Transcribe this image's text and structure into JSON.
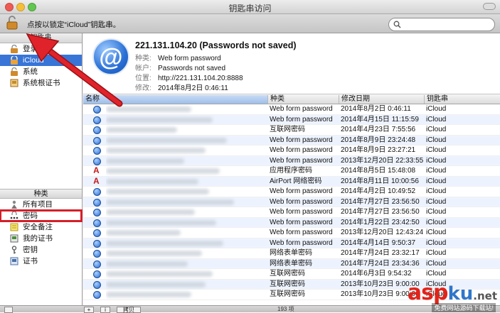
{
  "window": {
    "title": "钥匙串访问"
  },
  "toolbar": {
    "lock_label": "点按以锁定“iCloud”钥匙串。",
    "search_placeholder": ""
  },
  "sidebar": {
    "keychains_header": "钥匙串",
    "keychains": [
      {
        "label": "登录",
        "icon": "lock-icon"
      },
      {
        "label": "iCloud",
        "icon": "cloud-icon"
      },
      {
        "label": "系统",
        "icon": "lock-icon"
      },
      {
        "label": "系统根证书",
        "icon": "certificate-icon"
      }
    ],
    "category_header": "种类",
    "categories": [
      {
        "label": "所有项目",
        "icon": "people-icon"
      },
      {
        "label": "密码",
        "icon": "password-icon"
      },
      {
        "label": "安全备注",
        "icon": "note-icon"
      },
      {
        "label": "我的证书",
        "icon": "certificate-icon"
      },
      {
        "label": "密钥",
        "icon": "key-icon"
      },
      {
        "label": "证书",
        "icon": "certificate-icon"
      }
    ]
  },
  "detail": {
    "title": "221.131.104.20 (Passwords not saved)",
    "kind_label": "种类:",
    "kind": "Web form password",
    "account_label": "帐户:",
    "account": "Passwords not saved",
    "where_label": "位置:",
    "where": "http://221.131.104.20:8888",
    "modified_label": "修改:",
    "modified": "2014年8月2日 0:46:11"
  },
  "table": {
    "columns": [
      "名称",
      "种类",
      "修改日期",
      "钥匙串"
    ],
    "rows": [
      {
        "icon": "at",
        "kind": "Web form password",
        "date": "2014年8月2日 0:46:11",
        "chain": "iCloud"
      },
      {
        "icon": "at",
        "kind": "Web form password",
        "date": "2014年4月15日 11:15:59",
        "chain": "iCloud"
      },
      {
        "icon": "at",
        "kind": "互联网密码",
        "date": "2014年4月23日 7:55:56",
        "chain": "iCloud"
      },
      {
        "icon": "at",
        "kind": "Web form password",
        "date": "2014年8月9日 23:24:48",
        "chain": "iCloud"
      },
      {
        "icon": "at",
        "kind": "Web form password",
        "date": "2014年8月9日 23:27:21",
        "chain": "iCloud"
      },
      {
        "icon": "at",
        "kind": "Web form password",
        "date": "2013年12月20日 22:33:55",
        "chain": "iCloud"
      },
      {
        "icon": "app",
        "kind": "应用程序密码",
        "date": "2014年8月5日 15:48:08",
        "chain": "iCloud"
      },
      {
        "icon": "app",
        "kind": "AirPort 网络密码",
        "date": "2014年8月11日 10:00:56",
        "chain": "iCloud"
      },
      {
        "icon": "at",
        "kind": "Web form password",
        "date": "2014年4月2日 10:49:52",
        "chain": "iCloud"
      },
      {
        "icon": "at",
        "kind": "Web form password",
        "date": "2014年7月27日 23:56:50",
        "chain": "iCloud"
      },
      {
        "icon": "at",
        "kind": "Web form password",
        "date": "2014年7月27日 23:56:50",
        "chain": "iCloud"
      },
      {
        "icon": "at",
        "kind": "Web form password",
        "date": "2014年1月22日 23:42:50",
        "chain": "iCloud"
      },
      {
        "icon": "at",
        "kind": "Web form password",
        "date": "2013年12月20日 12:43:24",
        "chain": "iCloud"
      },
      {
        "icon": "at",
        "kind": "Web form password",
        "date": "2014年4月14日 9:50:37",
        "chain": "iCloud"
      },
      {
        "icon": "at",
        "kind": "网络表单密码",
        "date": "2014年7月24日 23:32:17",
        "chain": "iCloud"
      },
      {
        "icon": "at",
        "kind": "网络表单密码",
        "date": "2014年7月24日 23:34:36",
        "chain": "iCloud"
      },
      {
        "icon": "at",
        "kind": "互联网密码",
        "date": "2014年6月3日 9:54:32",
        "chain": "iCloud"
      },
      {
        "icon": "at",
        "kind": "互联网密码",
        "date": "2013年10月23日 9:00:00",
        "chain": "iCloud"
      },
      {
        "icon": "at",
        "kind": "互联网密码",
        "date": "2013年10月23日 9:00:00",
        "chain": "iCloud"
      }
    ]
  },
  "status": {
    "add_label": "+",
    "info_label": "i",
    "copy_label": "拷贝",
    "count": "193 项"
  },
  "watermark": {
    "asp": "asp",
    "ku": "ku",
    "net": ".net",
    "sub": "免费网站源码下载站!"
  },
  "colors": {
    "selection": "#3875d7",
    "highlight_box": "#d41f29",
    "arrow": "#e0232a"
  }
}
